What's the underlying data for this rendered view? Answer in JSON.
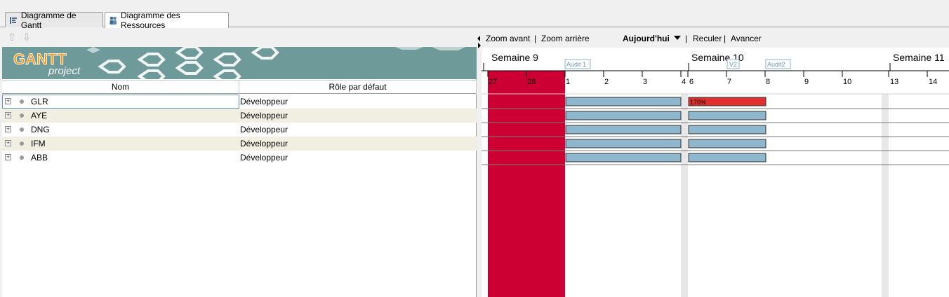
{
  "tabs": [
    {
      "label": "Diagramme de Gantt",
      "icon": "gantt-tree-icon",
      "active": false
    },
    {
      "label": "Diagramme des Ressources",
      "icon": "people-icon",
      "active": true
    }
  ],
  "logo": {
    "top": "GANTT",
    "bottom": "project"
  },
  "table": {
    "columns": [
      "Nom",
      "Rôle par défaut"
    ],
    "rows": [
      {
        "name": "GLR",
        "role": "Développeur"
      },
      {
        "name": "AYE",
        "role": "Développeur"
      },
      {
        "name": "DNG",
        "role": "Développeur"
      },
      {
        "name": "IFM",
        "role": "Développeur"
      },
      {
        "name": "ABB",
        "role": "Développeur"
      }
    ]
  },
  "chart_toolbar": {
    "zoom_in": "Zoom avant",
    "sep1": "|",
    "zoom_out": "Zoom arrière",
    "today": "Aujourd'hui",
    "sep2": "|",
    "back": "Reculer",
    "sep3": "|",
    "forward": "Avancer"
  },
  "timeline": {
    "weeks": [
      "Semaine 9",
      "Semaine 10",
      "Semaine 11"
    ],
    "days": [
      "27",
      "28",
      "1",
      "2",
      "3",
      "4",
      "6",
      "7",
      "8",
      "9",
      "10",
      "13",
      "14"
    ],
    "milestones": [
      "Audit 1",
      "V2",
      "Audit2"
    ],
    "overload_label": "170%"
  },
  "colors": {
    "overload_red": "#cc0033",
    "bar_blue": "#8eb6cc",
    "bar_red": "#e03030",
    "banner_teal": "#6e9b9a",
    "alt_row": "#f0efe1"
  }
}
